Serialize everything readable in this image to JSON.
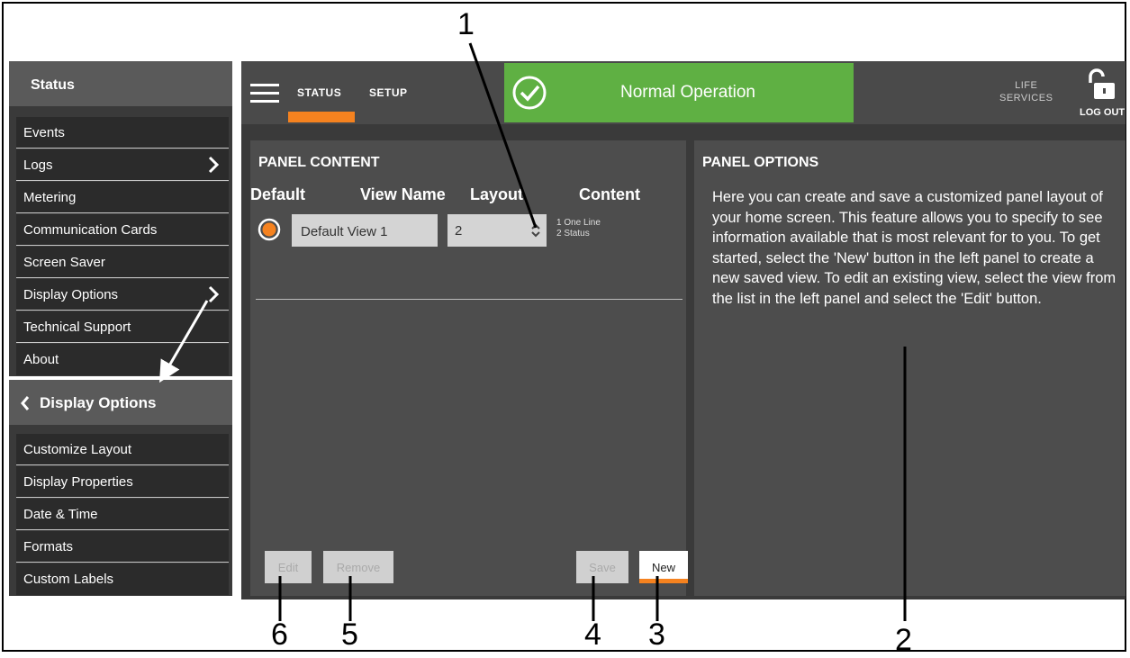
{
  "status_menu": {
    "header": "Status",
    "items": [
      {
        "label": "Events"
      },
      {
        "label": "Logs"
      },
      {
        "label": "Metering"
      },
      {
        "label": "Communication Cards"
      },
      {
        "label": "Screen Saver"
      },
      {
        "label": "Display Options"
      },
      {
        "label": "Technical Support"
      },
      {
        "label": "About"
      }
    ]
  },
  "display_menu": {
    "header": "Display Options",
    "items": [
      {
        "label": "Customize Layout"
      },
      {
        "label": "Display Properties"
      },
      {
        "label": "Date & Time"
      },
      {
        "label": "Formats"
      },
      {
        "label": "Custom Labels"
      }
    ]
  },
  "topbar": {
    "tabs": [
      {
        "label": "STATUS"
      },
      {
        "label": "SETUP"
      }
    ],
    "status_text": "Normal Operation",
    "life_services_line1": "LIFE",
    "life_services_line2": "SERVICES",
    "logout": "LOG OUT"
  },
  "panel_content": {
    "title": "PANEL CONTENT",
    "col_default": "Default",
    "col_view_name": "View Name",
    "col_layout": "Layout",
    "col_content": "Content",
    "row": {
      "view_name": "Default View 1",
      "layout": "2",
      "content_line1": "1 One Line",
      "content_line2": "2 Status"
    },
    "buttons": {
      "edit": "Edit",
      "remove": "Remove",
      "save": "Save",
      "new": "New"
    }
  },
  "panel_options": {
    "title": "PANEL OPTIONS",
    "description": "Here you can create and save a customized panel layout of your home screen. This feature allows you to specify to see information available that is most relevant for to you. To get started, select the 'New' button in the left panel to create a new saved view. To edit an existing view, select the view from the list in the left panel and select the 'Edit' button."
  },
  "callouts": [
    "1",
    "2",
    "3",
    "4",
    "5",
    "6"
  ],
  "colors": {
    "accent": "#f5821f",
    "status_green": "#5fb043",
    "panel_bg": "#4d4d4d"
  }
}
